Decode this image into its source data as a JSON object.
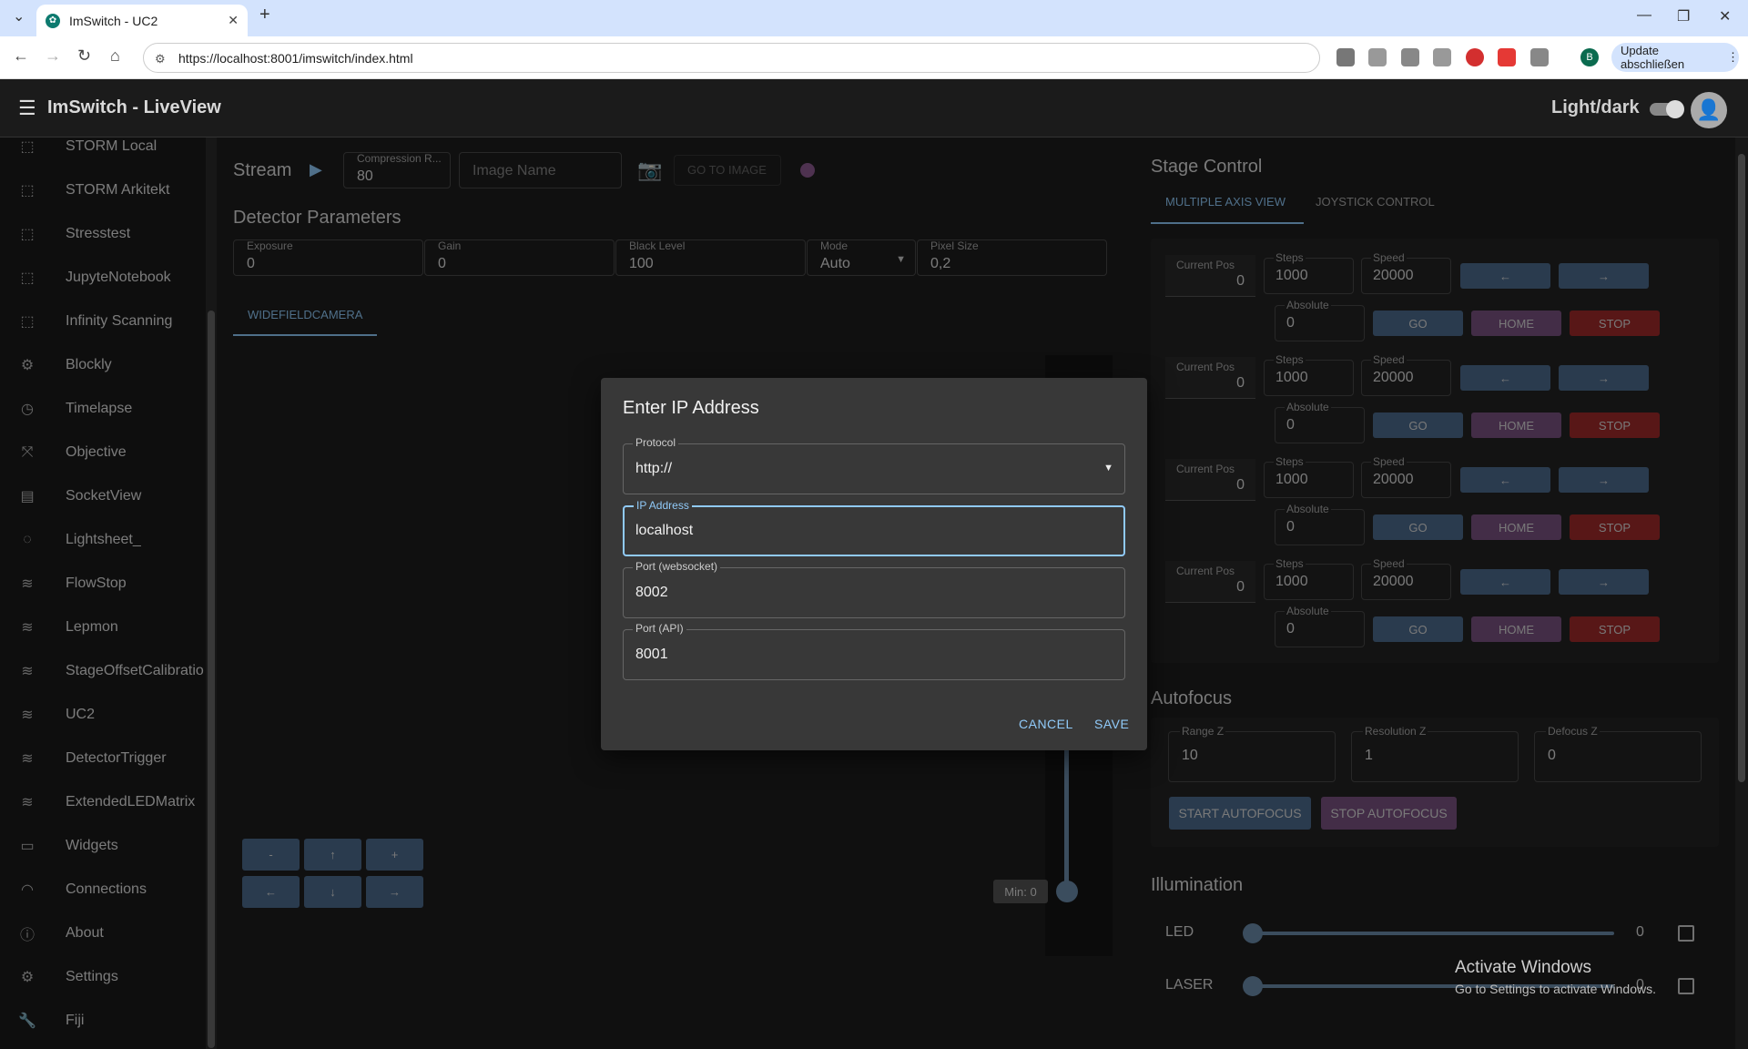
{
  "browser": {
    "tab_title": "ImSwitch - UC2",
    "url": "https://localhost:8001/imswitch/index.html",
    "update_label": "Update abschließen",
    "profile_initial": "B"
  },
  "app": {
    "title": "ImSwitch - LiveView",
    "light_dark_label": "Light/dark"
  },
  "sidebar": {
    "items": [
      {
        "label": "STORM Local",
        "icon": "frame-icon"
      },
      {
        "label": "STORM Arkitekt",
        "icon": "frame-icon"
      },
      {
        "label": "Stresstest",
        "icon": "frame-icon"
      },
      {
        "label": "JupyteNotebook",
        "icon": "frame-icon"
      },
      {
        "label": "Infinity Scanning",
        "icon": "frame-icon"
      },
      {
        "label": "Blockly",
        "icon": "gear-icon"
      },
      {
        "label": "Timelapse",
        "icon": "clock-icon"
      },
      {
        "label": "Objective",
        "icon": "expand-icon"
      },
      {
        "label": "SocketView",
        "icon": "chat-icon"
      },
      {
        "label": "Lightsheet_",
        "icon": "3d-icon"
      },
      {
        "label": "FlowStop",
        "icon": "wind-icon"
      },
      {
        "label": "Lepmon",
        "icon": "wind-icon"
      },
      {
        "label": "StageOffsetCalibratio",
        "icon": "wind-icon"
      },
      {
        "label": "UC2",
        "icon": "wind-icon"
      },
      {
        "label": "DetectorTrigger",
        "icon": "wind-icon"
      },
      {
        "label": "ExtendedLEDMatrix",
        "icon": "wind-icon"
      },
      {
        "label": "Widgets",
        "icon": "devices-icon"
      },
      {
        "label": "Connections",
        "icon": "wifi-icon"
      },
      {
        "label": "About",
        "icon": "info-icon"
      },
      {
        "label": "Settings",
        "icon": "gear-icon"
      },
      {
        "label": "Fiji",
        "icon": "wrench-icon"
      }
    ]
  },
  "stream": {
    "label": "Stream",
    "compression_label": "Compression R...",
    "compression_value": "80",
    "image_name_placeholder": "Image Name",
    "go_to_image_label": "GO TO IMAGE"
  },
  "detector": {
    "heading": "Detector Parameters",
    "exposure_label": "Exposure",
    "exposure_value": "0",
    "gain_label": "Gain",
    "gain_value": "0",
    "black_level_label": "Black Level",
    "black_level_value": "100",
    "mode_label": "Mode",
    "mode_value": "Auto",
    "pixel_size_label": "Pixel Size",
    "pixel_size_value": "0,2",
    "camera_tab": "WIDEFIELDCAMERA"
  },
  "nav_pad": {
    "minus": "-",
    "up": "↑",
    "plus": "+",
    "left": "←",
    "down": "↓",
    "right": "→"
  },
  "vertical_slider": {
    "min_label": "Min: 0"
  },
  "stage": {
    "heading": "Stage Control",
    "tab_multi": "MULTIPLE AXIS VIEW",
    "tab_joystick": "JOYSTICK CONTROL",
    "current_pos_label": "Current Pos",
    "steps_label": "Steps",
    "speed_label": "Speed",
    "absolute_label": "Absolute",
    "go_label": "GO",
    "home_label": "HOME",
    "stop_label": "STOP",
    "left_arrow": "←",
    "right_arrow": "→",
    "axes": [
      {
        "pos": "0",
        "steps": "1000",
        "speed": "20000",
        "absolute": "0"
      },
      {
        "pos": "0",
        "steps": "1000",
        "speed": "20000",
        "absolute": "0"
      },
      {
        "pos": "0",
        "steps": "1000",
        "speed": "20000",
        "absolute": "0"
      },
      {
        "pos": "0",
        "steps": "1000",
        "speed": "20000",
        "absolute": "0"
      }
    ]
  },
  "autofocus": {
    "heading": "Autofocus",
    "range_label": "Range Z",
    "range_value": "10",
    "resolution_label": "Resolution Z",
    "resolution_value": "1",
    "defocus_label": "Defocus Z",
    "defocus_value": "0",
    "start_label": "START AUTOFOCUS",
    "stop_label": "STOP AUTOFOCUS"
  },
  "illumination": {
    "heading": "Illumination",
    "led_label": "LED",
    "led_value": "0",
    "laser_label": "LASER",
    "laser_value": "0"
  },
  "watermark": {
    "title": "Activate Windows",
    "subtitle": "Go to Settings to activate Windows."
  },
  "dialog": {
    "title": "Enter IP Address",
    "protocol_label": "Protocol",
    "protocol_value": "http://",
    "ip_label": "IP Address",
    "ip_value": "localhost",
    "ws_port_label": "Port (websocket)",
    "ws_port_value": "8002",
    "api_port_label": "Port (API)",
    "api_port_value": "8001",
    "cancel_label": "CANCEL",
    "save_label": "SAVE"
  }
}
